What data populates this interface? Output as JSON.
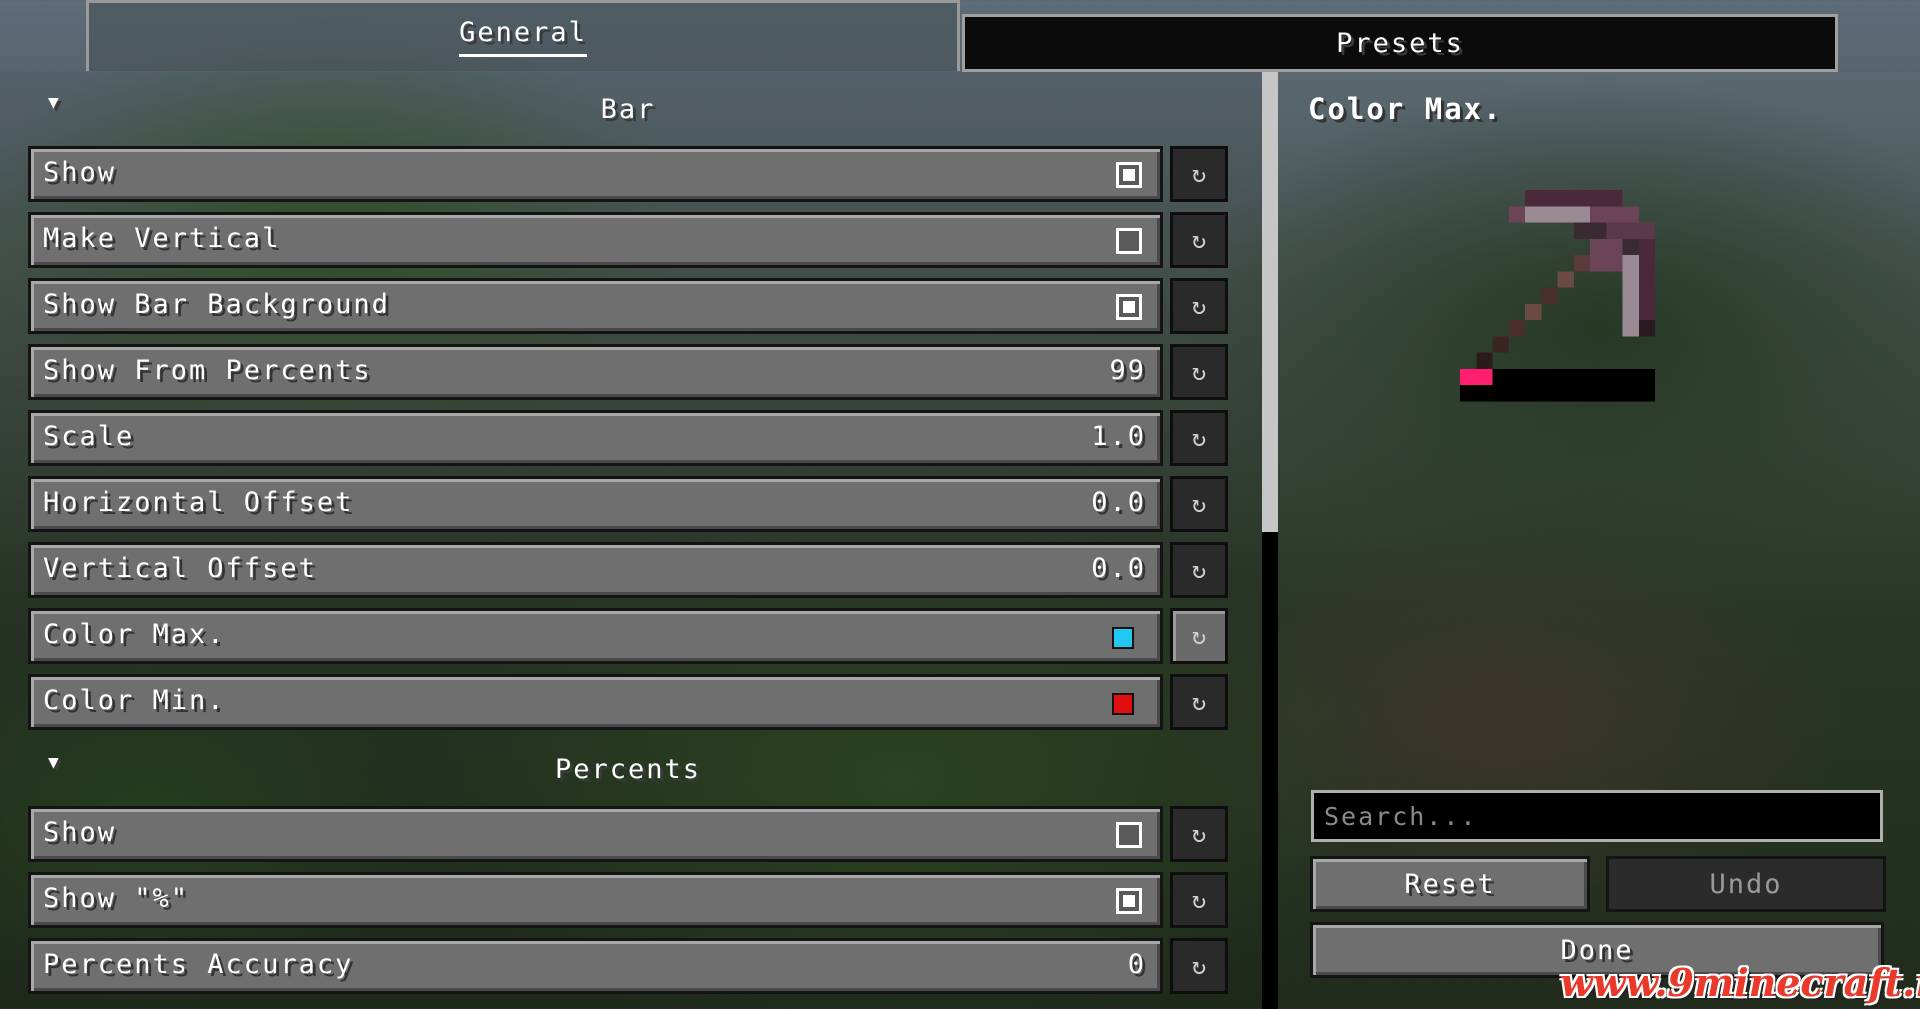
{
  "tabs": {
    "general": "General",
    "presets": "Presets"
  },
  "sections": [
    {
      "title": "Bar",
      "rows": [
        {
          "label": "Show",
          "kind": "checkbox",
          "checked": true
        },
        {
          "label": "Make Vertical",
          "kind": "checkbox",
          "checked": false
        },
        {
          "label": "Show Bar Background",
          "kind": "checkbox",
          "checked": true
        },
        {
          "label": "Show From Percents",
          "kind": "value",
          "value": "99"
        },
        {
          "label": "Scale",
          "kind": "value",
          "value": "1.0"
        },
        {
          "label": "Horizontal Offset",
          "kind": "value",
          "value": "0.0"
        },
        {
          "label": "Vertical Offset",
          "kind": "value",
          "value": "0.0"
        },
        {
          "label": "Color Max.",
          "kind": "color",
          "color": "#22c8f0",
          "selected": true
        },
        {
          "label": "Color Min.",
          "kind": "color",
          "color": "#e01010"
        }
      ]
    },
    {
      "title": "Percents",
      "rows": [
        {
          "label": "Show",
          "kind": "checkbox",
          "checked": false
        },
        {
          "label": "Show \"%\"",
          "kind": "checkbox",
          "checked": true
        },
        {
          "label": "Percents Accuracy",
          "kind": "value",
          "value": "0"
        }
      ]
    }
  ],
  "reset_icon": "↻",
  "collapse_icon": "▼",
  "details": {
    "title": "Color Max.",
    "preview_item": "pickaxe-icon",
    "bar_fill_color": "#ff1f6e"
  },
  "search": {
    "placeholder": "Search..."
  },
  "buttons": {
    "reset": "Reset",
    "undo": "Undo",
    "done": "Done"
  },
  "watermark": "www.9minecraft.net"
}
